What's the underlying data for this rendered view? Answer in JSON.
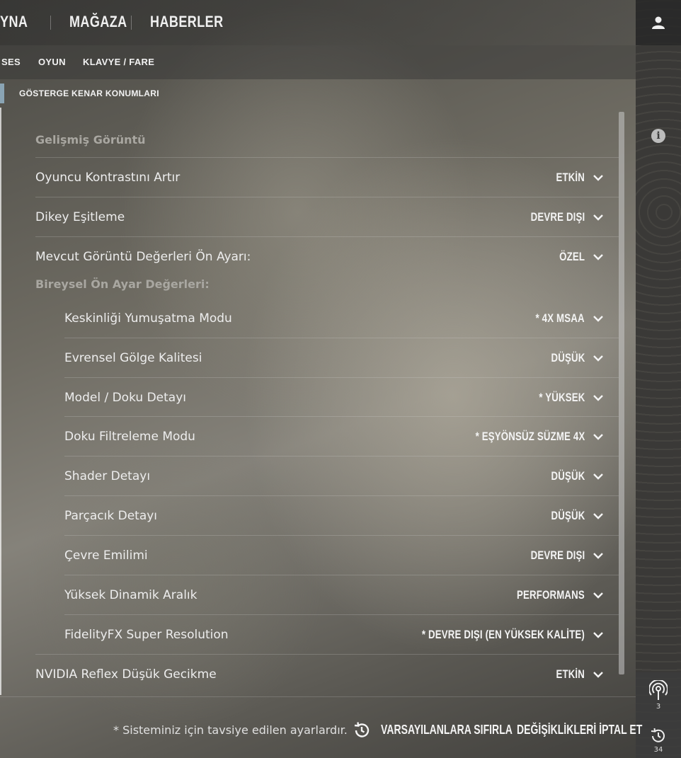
{
  "topnav": {
    "items": [
      "YNA",
      "MAĞAZA",
      "HABERLER"
    ]
  },
  "subnav": {
    "tabs": [
      "SES",
      "OYUN",
      "KLAVYE / FARE"
    ],
    "subtab": "GÖSTERGE KENAR KONUMLARI"
  },
  "settings": {
    "heading_advanced": "Gelişmiş Görüntü",
    "heading_individual": "Bireysel Ön Ayar Değerleri:",
    "top_rows": [
      {
        "label": "Oyuncu Kontrastını Artır",
        "value": "ETKİN"
      },
      {
        "label": "Dikey Eşitleme",
        "value": "DEVRE DIŞI"
      },
      {
        "label": "Mevcut Görüntü Değerleri Ön Ayarı:",
        "value": "ÖZEL"
      }
    ],
    "indent_rows": [
      {
        "label": "Keskinliği Yumuşatma Modu",
        "value": "* 4X MSAA"
      },
      {
        "label": "Evrensel Gölge Kalitesi",
        "value": "DÜŞÜK"
      },
      {
        "label": "Model / Doku Detayı",
        "value": "* YÜKSEK"
      },
      {
        "label": "Doku Filtreleme Modu",
        "value": "* EŞYÖNSÜZ SÜZME 4X"
      },
      {
        "label": "Shader Detayı",
        "value": "DÜŞÜK"
      },
      {
        "label": "Parçacık Detayı",
        "value": "DÜŞÜK"
      },
      {
        "label": "Çevre Emilimi",
        "value": "DEVRE DIŞI"
      },
      {
        "label": "Yüksek Dinamik Aralık",
        "value": "PERFORMANS"
      },
      {
        "label": "FidelityFX Super Resolution",
        "value": "* DEVRE DIŞI (EN YÜKSEK KALİTE)"
      }
    ],
    "bottom_row": {
      "label": "NVIDIA Reflex Düşük Gecikme",
      "value": "ETKİN"
    }
  },
  "footer": {
    "note": "* Sisteminiz için tavsiye edilen ayarlardır.",
    "reset": "VARSAYILANLARA SIFIRLA",
    "cancel": "DEĞİŞİKLİKLERİ İPTAL ET"
  },
  "side": {
    "broadcast_count": "3",
    "history_count": "34"
  },
  "icons": {
    "user": "user-icon",
    "info": "info-icon",
    "broadcast": "broadcast-icon",
    "history": "history-icon",
    "reset": "reset-icon",
    "chevron": "chevron-down-icon"
  }
}
